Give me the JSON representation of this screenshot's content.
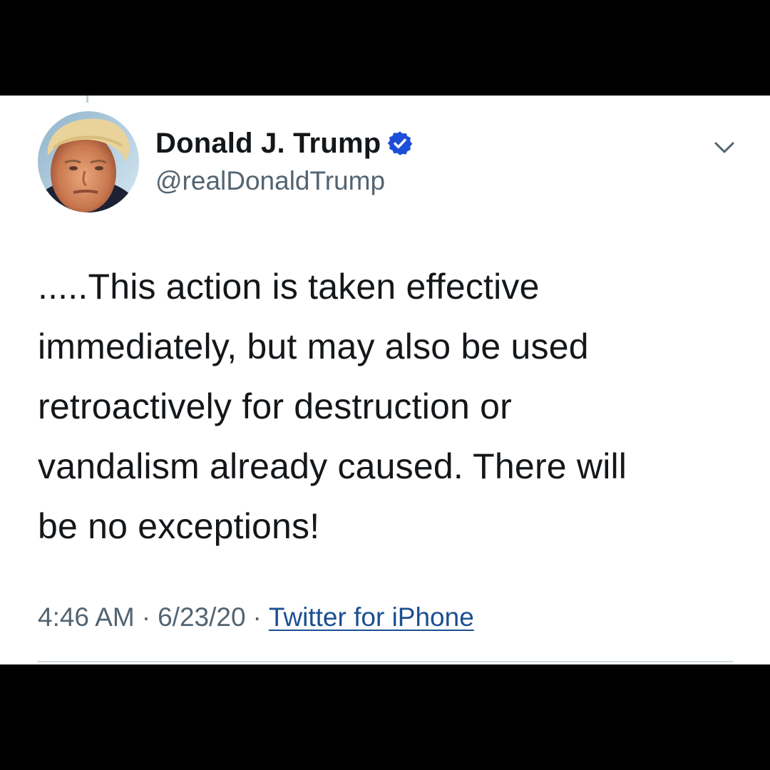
{
  "tweet": {
    "author": {
      "display_name": "Donald J. Trump",
      "handle": "@realDonaldTrump",
      "verified": true
    },
    "text": ".....This action is taken effective\nimmediately, but may also be used\nretroactively for destruction or\nvandalism already caused. There will\nbe no exceptions!",
    "time": "4:46 AM",
    "separator": "·",
    "date": "6/23/20",
    "source": "Twitter for iPhone"
  },
  "icons": {
    "verified": "verified-badge-icon",
    "more": "chevron-down-icon",
    "verified_color": "#1d4ed8",
    "link_color": "#1b4f91"
  }
}
